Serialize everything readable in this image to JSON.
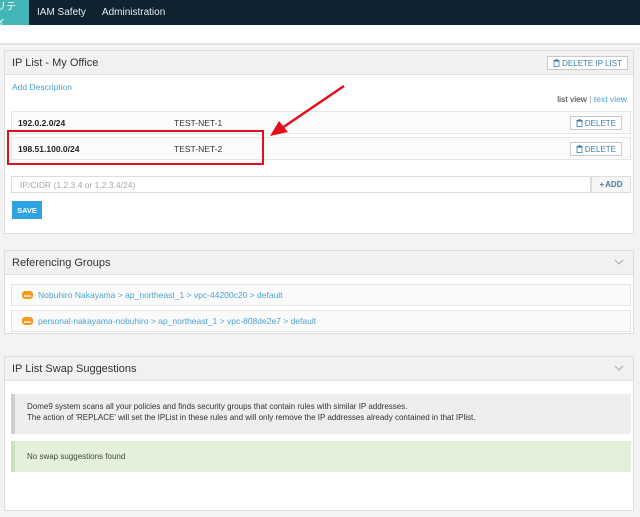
{
  "nav": {
    "items": [
      {
        "label": "リティ",
        "active": true
      },
      {
        "label": "IAM Safety",
        "active": false
      },
      {
        "label": "Administration",
        "active": false
      }
    ]
  },
  "ip_list": {
    "title": "IP List - My Office",
    "delete_list_label": "DELETE IP LIST",
    "add_description": "Add Description",
    "view_list": "list view",
    "view_sep": "|",
    "view_text": "text view",
    "rows": [
      {
        "cidr": "192.0.2.0/24",
        "description": "TEST-NET-1",
        "delete_label": "DELETE"
      },
      {
        "cidr": "198.51.100.0/24",
        "description": "TEST-NET-2",
        "delete_label": "DELETE"
      }
    ],
    "input_placeholder": "IP/CIDR (1.2.3.4 or 1.2.3.4/24)",
    "add_label": "ADD",
    "save_label": "SAVE"
  },
  "referencing": {
    "title": "Referencing Groups",
    "groups": [
      {
        "icon": "aws-icon",
        "path": "Nobuhiro Nakayama > ap_northeast_1 > vpc-44200c20 > default"
      },
      {
        "icon": "aws-icon",
        "path": "personal-nakayama-nobuhiro > ap_northeast_1 > vpc-808de2e7 > default"
      }
    ]
  },
  "swap": {
    "title": "IP List Swap Suggestions",
    "info_line1": "Dome9 system scans all your policies and finds security groups that contain rules with similar IP addresses.",
    "info_line2": "The action of 'REPLACE' will set the IPList in these rules and will only remove the IP addresses already contained in that IPlist.",
    "no_suggestions": "No swap suggestions found"
  },
  "colors": {
    "nav_bg": "#0f2230",
    "nav_active": "#44b5b7",
    "link": "#4aa3d3",
    "save": "#2ea3e0",
    "annotation": "#e0101d",
    "aws": "#f39a1e"
  }
}
